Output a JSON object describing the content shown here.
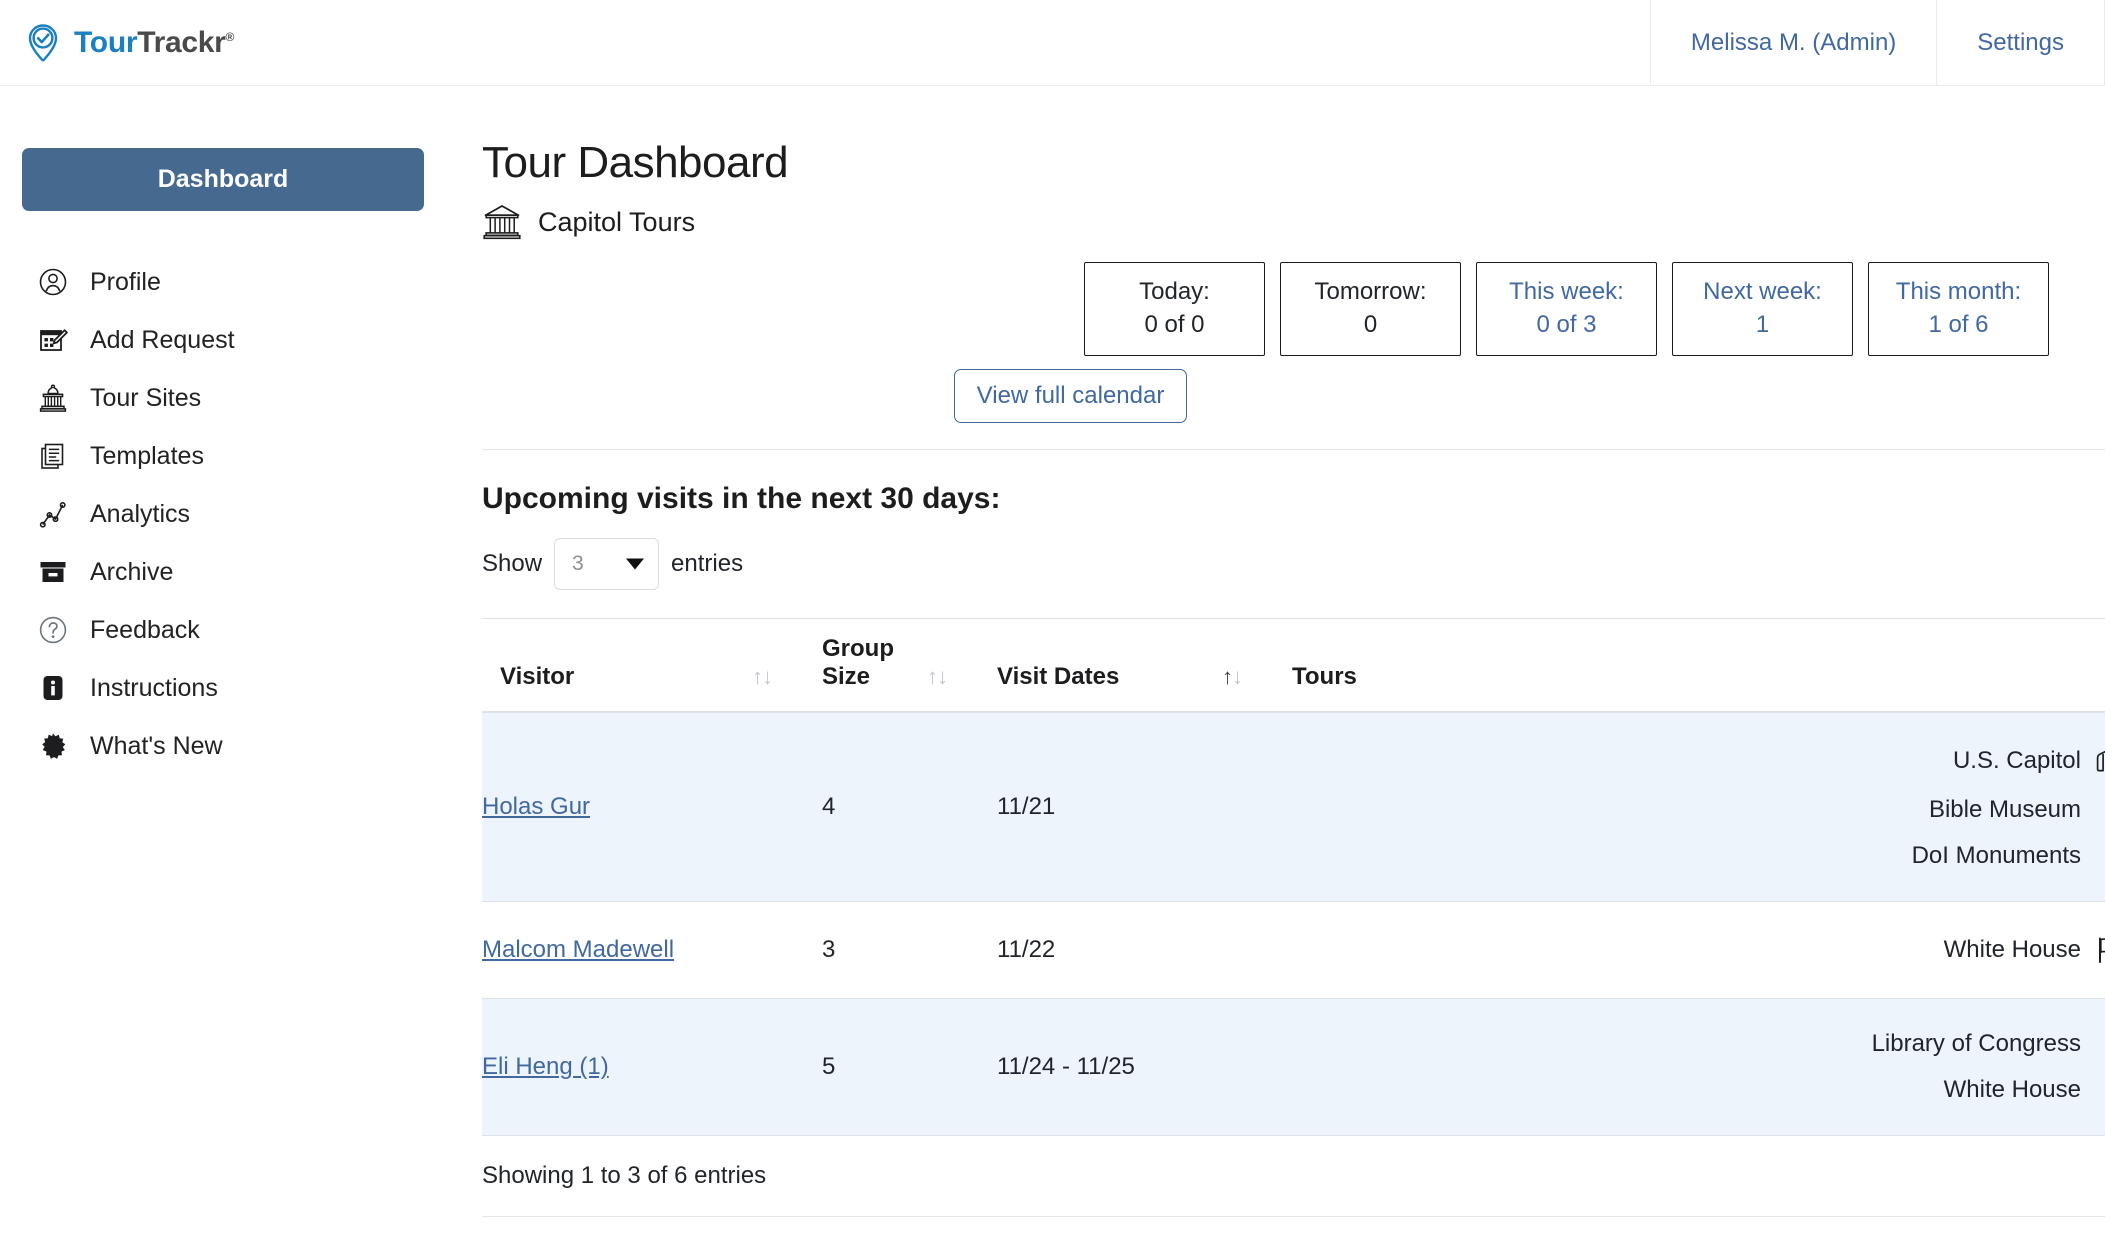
{
  "brand": {
    "part1": "Tour",
    "part2": "Trackr",
    "tm": "®"
  },
  "topnav": {
    "user": "Melissa M. (Admin)",
    "settings": "Settings"
  },
  "sidebar": {
    "dashboard_label": "Dashboard",
    "items": [
      {
        "label": "Profile",
        "icon": "user-circle-icon"
      },
      {
        "label": "Add Request",
        "icon": "calendar-edit-icon"
      },
      {
        "label": "Tour Sites",
        "icon": "capitol-building-icon"
      },
      {
        "label": "Templates",
        "icon": "documents-icon"
      },
      {
        "label": "Analytics",
        "icon": "chart-nodes-icon"
      },
      {
        "label": "Archive",
        "icon": "archive-box-icon"
      },
      {
        "label": "Feedback",
        "icon": "question-circle-icon"
      },
      {
        "label": "Instructions",
        "icon": "info-filled-icon"
      },
      {
        "label": "What's New",
        "icon": "starburst-icon"
      }
    ]
  },
  "main": {
    "title": "Tour Dashboard",
    "org": "Capitol Tours",
    "org_icon": "classical-building-icon",
    "counters": [
      {
        "label": "Today:",
        "value": "0 of 0",
        "link": false
      },
      {
        "label": "Tomorrow:",
        "value": "0",
        "link": false
      },
      {
        "label": "This week:",
        "value": "0 of 3",
        "link": true
      },
      {
        "label": "Next week:",
        "value": "1",
        "link": true
      },
      {
        "label": "This month:",
        "value": "1 of 6",
        "link": true
      }
    ],
    "calendar_button": "View full calendar",
    "section_title": "Upcoming visits in the next 30 days:",
    "show_prefix": "Show",
    "show_value": "3",
    "show_suffix": "entries",
    "table": {
      "headers": {
        "visitor": "Visitor",
        "group_size_line1": "Group",
        "group_size_line2": "Size",
        "visit_dates": "Visit Dates",
        "tours": "Tours"
      },
      "rows": [
        {
          "visitor": "Holas Gur",
          "group_size": "4",
          "visit_dates": "11/21",
          "tours": [
            {
              "name": "U.S. Capitol",
              "icon": "coat-icon"
            },
            {
              "name": "Bible Museum",
              "icon": ""
            },
            {
              "name": "DoI Monuments",
              "icon": ""
            }
          ]
        },
        {
          "visitor": "Malcom Madewell",
          "group_size": "3",
          "visit_dates": "11/22",
          "tours": [
            {
              "name": "White House",
              "icon": "flag-star-icon"
            }
          ]
        },
        {
          "visitor": "Eli Heng (1)",
          "group_size": "5",
          "visit_dates": "11/24 - 11/25",
          "tours": [
            {
              "name": "Library of Congress",
              "icon": ""
            },
            {
              "name": "White House",
              "icon": ""
            }
          ]
        }
      ],
      "footer": "Showing 1 to 3 of 6 entries"
    }
  },
  "colors": {
    "brand_blue": "#1b7fc4",
    "link_blue": "#41689f",
    "dashboard_bg": "#46698f",
    "row_stripe": "#edf4fc"
  }
}
